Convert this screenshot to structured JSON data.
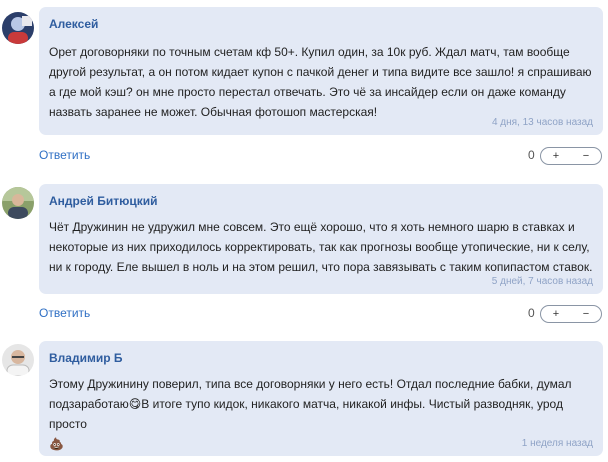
{
  "comments": [
    {
      "author": "Алексей",
      "text": "Орет договорняки по точным счетам кф 50+. Купил один, за 10к руб. Ждал матч, там вообще другой результат, а он потом кидает купон с пачкой денег и типа видите все зашло! я спрашиваю а где мой кэш? он мне просто перестал отвечать. Это чё за инсайдер если он даже команду назвать заранее не может. Обычная фотошоп мастерская!",
      "date": "4 дня, 13 часов назад",
      "reply_label": "Ответить",
      "score": "0",
      "plus_label": "+",
      "minus_label": "−"
    },
    {
      "author": "Андрей Битюцкий",
      "text": "Чёт Дружинин не удружил мне совсем. Это ещё хорошо, что я хоть немного шарю в ставках и некоторые из них приходилось корректировать, так как прогнозы вообще утопические, ни к селу, ни к городу. Еле вышел в ноль и на этом решил, что пора завязывать с таким копипастом ставок.",
      "date": "5 дней, 7 часов назад",
      "reply_label": "Ответить",
      "score": "0",
      "plus_label": "+",
      "minus_label": "−"
    },
    {
      "author": "Владимир Б",
      "text_part1": "Этому Дружинину поверил, типа все договорняки у него есть! Отдал последние бабки, думал подзаработаю",
      "emoji1": "😋",
      "text_part2": "В итоге тупо кидок, никакого матча, никакой инфы. Чистый разводняк, урод просто",
      "emoji2": "💩",
      "date": "1 неделя назад"
    }
  ]
}
